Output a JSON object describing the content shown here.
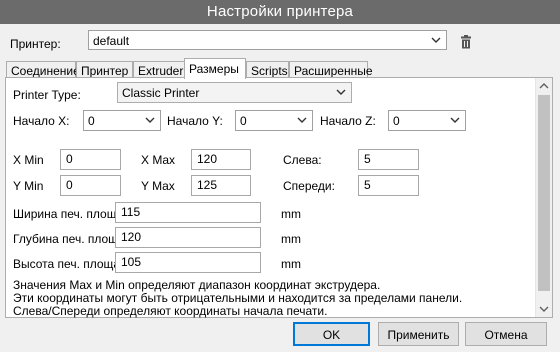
{
  "window": {
    "title": "Настройки принтера"
  },
  "printer": {
    "label": "Принтер:",
    "value": "default",
    "delete_icon": "trash-icon"
  },
  "tabs": [
    {
      "label": "Соединение",
      "active": false
    },
    {
      "label": "Принтер",
      "active": false
    },
    {
      "label": "Extruder",
      "active": false
    },
    {
      "label": "Размеры",
      "active": true
    },
    {
      "label": "Scripts",
      "active": false
    },
    {
      "label": "Расширенные",
      "active": false
    }
  ],
  "dimensions": {
    "printer_type": {
      "label": "Printer Type:",
      "value": "Classic Printer"
    },
    "origin_x": {
      "label": "Начало X:",
      "value": "0"
    },
    "origin_y": {
      "label": "Начало Y:",
      "value": "0"
    },
    "origin_z": {
      "label": "Начало Z:",
      "value": "0"
    },
    "x_min": {
      "label": "X Min",
      "value": "0"
    },
    "x_max": {
      "label": "X Max",
      "value": "120"
    },
    "left": {
      "label": "Слева:",
      "value": "5"
    },
    "y_min": {
      "label": "Y Min",
      "value": "0"
    },
    "y_max": {
      "label": "Y Max",
      "value": "125"
    },
    "front": {
      "label": "Спереди:",
      "value": "5"
    },
    "bed_width": {
      "label": "Ширина печ. площади:",
      "value": "115",
      "unit": "mm"
    },
    "bed_depth": {
      "label": "Глубина печ. площади:",
      "value": "120",
      "unit": "mm"
    },
    "bed_height": {
      "label": "Высота печ. площади:",
      "value": "105",
      "unit": "mm"
    },
    "note": [
      "Значения Max и Min определяют диапазон координат экструдера.",
      "Эти координаты могут быть отрицательными и находится за пределами панели.",
      "Слева/Спереди определяют координаты начала печати."
    ]
  },
  "buttons": {
    "ok": "OK",
    "apply": "Применить",
    "cancel": "Отмена"
  }
}
